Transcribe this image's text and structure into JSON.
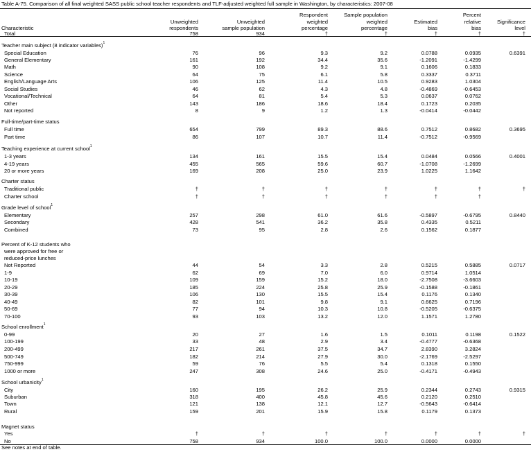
{
  "title": "Table A-75. Comparison of all final weighted SASS public school teacher respondents and TLF-adjusted weighted full sample in Washington, by characteristics: 2007-08",
  "columns": [
    {
      "key": "characteristic",
      "lines": [
        "Characteristic"
      ]
    },
    {
      "key": "unw_resp",
      "lines": [
        "Unweighted",
        "respondents"
      ]
    },
    {
      "key": "unw_pop",
      "lines": [
        "Unweighted",
        "sample population"
      ]
    },
    {
      "key": "resp_pct",
      "lines": [
        "Respondent",
        "weighted",
        "percentage"
      ]
    },
    {
      "key": "pop_pct",
      "lines": [
        "Sample population",
        "weighted",
        "percentage"
      ]
    },
    {
      "key": "bias",
      "lines": [
        "Estimated",
        "bias"
      ]
    },
    {
      "key": "rel_bias",
      "lines": [
        "Percent",
        "relative",
        "bias"
      ]
    },
    {
      "key": "sig",
      "lines": [
        "Significance",
        "level"
      ]
    }
  ],
  "rows": [
    {
      "type": "item",
      "label": "Total",
      "values": [
        "758",
        "934",
        "†",
        "†",
        "†",
        "†",
        "†"
      ]
    },
    {
      "type": "group",
      "label": "Teacher main subject (8 indicator variables)",
      "sup": "1"
    },
    {
      "type": "item",
      "label": "Special Education",
      "values": [
        "76",
        "96",
        "9.3",
        "9.2",
        "0.0788",
        "0.0935",
        "0.6391"
      ]
    },
    {
      "type": "item",
      "label": "General Elementary",
      "values": [
        "161",
        "192",
        "34.4",
        "35.6",
        "-1.2091",
        "-1.4299",
        ""
      ]
    },
    {
      "type": "item",
      "label": "Math",
      "values": [
        "90",
        "108",
        "9.2",
        "9.1",
        "0.1606",
        "0.1833",
        ""
      ]
    },
    {
      "type": "item",
      "label": "Science",
      "values": [
        "64",
        "75",
        "6.1",
        "5.8",
        "0.3337",
        "0.3711",
        ""
      ]
    },
    {
      "type": "item",
      "label": "English/Language Arts",
      "values": [
        "106",
        "125",
        "11.4",
        "10.5",
        "0.9283",
        "1.0304",
        ""
      ]
    },
    {
      "type": "item",
      "label": "Social Studies",
      "values": [
        "46",
        "62",
        "4.3",
        "4.8",
        "-0.4869",
        "-0.6453",
        ""
      ]
    },
    {
      "type": "item",
      "label": "Vocational/Technical",
      "values": [
        "64",
        "81",
        "5.4",
        "5.3",
        "0.0637",
        "0.0762",
        ""
      ]
    },
    {
      "type": "item",
      "label": "Other",
      "values": [
        "143",
        "186",
        "18.6",
        "18.4",
        "0.1723",
        "0.2035",
        ""
      ]
    },
    {
      "type": "item",
      "label": "Not reported",
      "values": [
        "8",
        "9",
        "1.2",
        "1.3",
        "-0.0414",
        "-0.0442",
        ""
      ]
    },
    {
      "type": "group",
      "label": "Full-time/part-time status"
    },
    {
      "type": "item",
      "label": "Full time",
      "values": [
        "654",
        "799",
        "89.3",
        "88.6",
        "0.7512",
        "0.8682",
        "0.3695"
      ]
    },
    {
      "type": "item",
      "label": "Part time",
      "values": [
        "86",
        "107",
        "10.7",
        "11.4",
        "-0.7512",
        "-0.9569",
        ""
      ]
    },
    {
      "type": "group",
      "label": "Teaching experience at current school",
      "sup": "1"
    },
    {
      "type": "item",
      "label": "1-3 years",
      "values": [
        "134",
        "161",
        "15.5",
        "15.4",
        "0.0484",
        "0.0566",
        "0.4001"
      ]
    },
    {
      "type": "item",
      "label": "4-19 years",
      "values": [
        "455",
        "565",
        "59.6",
        "60.7",
        "-1.0708",
        "-1.2699",
        ""
      ]
    },
    {
      "type": "item",
      "label": "20 or more years",
      "values": [
        "169",
        "208",
        "25.0",
        "23.9",
        "1.0225",
        "1.1642",
        ""
      ]
    },
    {
      "type": "group",
      "label": "Charter status"
    },
    {
      "type": "item",
      "label": "Traditional public",
      "values": [
        "†",
        "†",
        "†",
        "†",
        "†",
        "†",
        "†"
      ]
    },
    {
      "type": "item",
      "label": "Charter school",
      "values": [
        "†",
        "†",
        "†",
        "†",
        "†",
        "†",
        ""
      ]
    },
    {
      "type": "group",
      "label": "Grade level of school",
      "sup": "1"
    },
    {
      "type": "item",
      "label": "Elementary",
      "values": [
        "257",
        "298",
        "61.0",
        "61.6",
        "-0.5897",
        "-0.6795",
        "0.8440"
      ]
    },
    {
      "type": "item",
      "label": "Secondary",
      "values": [
        "428",
        "541",
        "36.2",
        "35.8",
        "0.4335",
        "0.5211",
        ""
      ]
    },
    {
      "type": "item",
      "label": "Combined",
      "values": [
        "73",
        "95",
        "2.8",
        "2.6",
        "0.1562",
        "0.1877",
        ""
      ]
    },
    {
      "type": "group",
      "label": "Percent of K-12 students who"
    },
    {
      "type": "subgroup",
      "label": "were approved for free or"
    },
    {
      "type": "subgroup",
      "label": "reduced-price lunches"
    },
    {
      "type": "item",
      "label": "Not Reported",
      "values": [
        "44",
        "54",
        "3.3",
        "2.8",
        "0.5215",
        "0.5885",
        "0.0717"
      ]
    },
    {
      "type": "item",
      "label": "1-9",
      "values": [
        "62",
        "69",
        "7.0",
        "6.0",
        "0.9714",
        "1.0514",
        ""
      ]
    },
    {
      "type": "item",
      "label": "10-19",
      "values": [
        "109",
        "159",
        "15.2",
        "18.0",
        "-2.7508",
        "-3.6603",
        ""
      ]
    },
    {
      "type": "item",
      "label": "20-29",
      "values": [
        "185",
        "224",
        "25.8",
        "25.9",
        "-0.1588",
        "-0.1861",
        ""
      ]
    },
    {
      "type": "item",
      "label": "30-39",
      "values": [
        "106",
        "130",
        "15.5",
        "15.4",
        "0.1176",
        "0.1340",
        ""
      ]
    },
    {
      "type": "item",
      "label": "40-49",
      "values": [
        "82",
        "101",
        "9.8",
        "9.1",
        "0.6625",
        "0.7196",
        ""
      ]
    },
    {
      "type": "item",
      "label": "50-69",
      "values": [
        "77",
        "94",
        "10.3",
        "10.8",
        "-0.5205",
        "-0.6375",
        ""
      ]
    },
    {
      "type": "item",
      "label": "70-100",
      "values": [
        "93",
        "103",
        "13.2",
        "12.0",
        "1.1571",
        "1.2780",
        ""
      ]
    },
    {
      "type": "group",
      "label": "School enrollment",
      "sup": "1"
    },
    {
      "type": "item",
      "label": "0-99",
      "values": [
        "20",
        "27",
        "1.6",
        "1.5",
        "0.1011",
        "0.1198",
        "0.1522"
      ]
    },
    {
      "type": "item",
      "label": "100-199",
      "values": [
        "33",
        "48",
        "2.9",
        "3.4",
        "-0.4777",
        "-0.6368",
        ""
      ]
    },
    {
      "type": "item",
      "label": "200-499",
      "values": [
        "217",
        "261",
        "37.5",
        "34.7",
        "2.8390",
        "3.2824",
        ""
      ]
    },
    {
      "type": "item",
      "label": "500-749",
      "values": [
        "182",
        "214",
        "27.9",
        "30.0",
        "-2.1769",
        "-2.5297",
        ""
      ]
    },
    {
      "type": "item",
      "label": "750-999",
      "values": [
        "59",
        "76",
        "5.5",
        "5.4",
        "0.1318",
        "0.1550",
        ""
      ]
    },
    {
      "type": "item",
      "label": "1000 or more",
      "values": [
        "247",
        "308",
        "24.6",
        "25.0",
        "-0.4171",
        "-0.4943",
        ""
      ]
    },
    {
      "type": "group",
      "label": "School urbanicity",
      "sup": "1"
    },
    {
      "type": "item",
      "label": "City",
      "values": [
        "160",
        "195",
        "26.2",
        "25.9",
        "0.2344",
        "0.2743",
        "0.9315"
      ]
    },
    {
      "type": "item",
      "label": "Suburban",
      "values": [
        "318",
        "400",
        "45.8",
        "45.6",
        "0.2120",
        "0.2510",
        ""
      ]
    },
    {
      "type": "item",
      "label": "Town",
      "values": [
        "121",
        "138",
        "12.1",
        "12.7",
        "-0.5643",
        "-0.6414",
        ""
      ]
    },
    {
      "type": "item",
      "label": "Rural",
      "values": [
        "159",
        "201",
        "15.9",
        "15.8",
        "0.1179",
        "0.1373",
        ""
      ]
    },
    {
      "type": "group",
      "label": "Magnet status"
    },
    {
      "type": "item",
      "label": "Yes",
      "values": [
        "†",
        "†",
        "†",
        "†",
        "†",
        "†",
        "†"
      ]
    },
    {
      "type": "item",
      "label": "No",
      "values": [
        "758",
        "934",
        "100.0",
        "100.0",
        "0.0000",
        "0.0000",
        ""
      ]
    }
  ],
  "footnote": "See notes at end of table."
}
